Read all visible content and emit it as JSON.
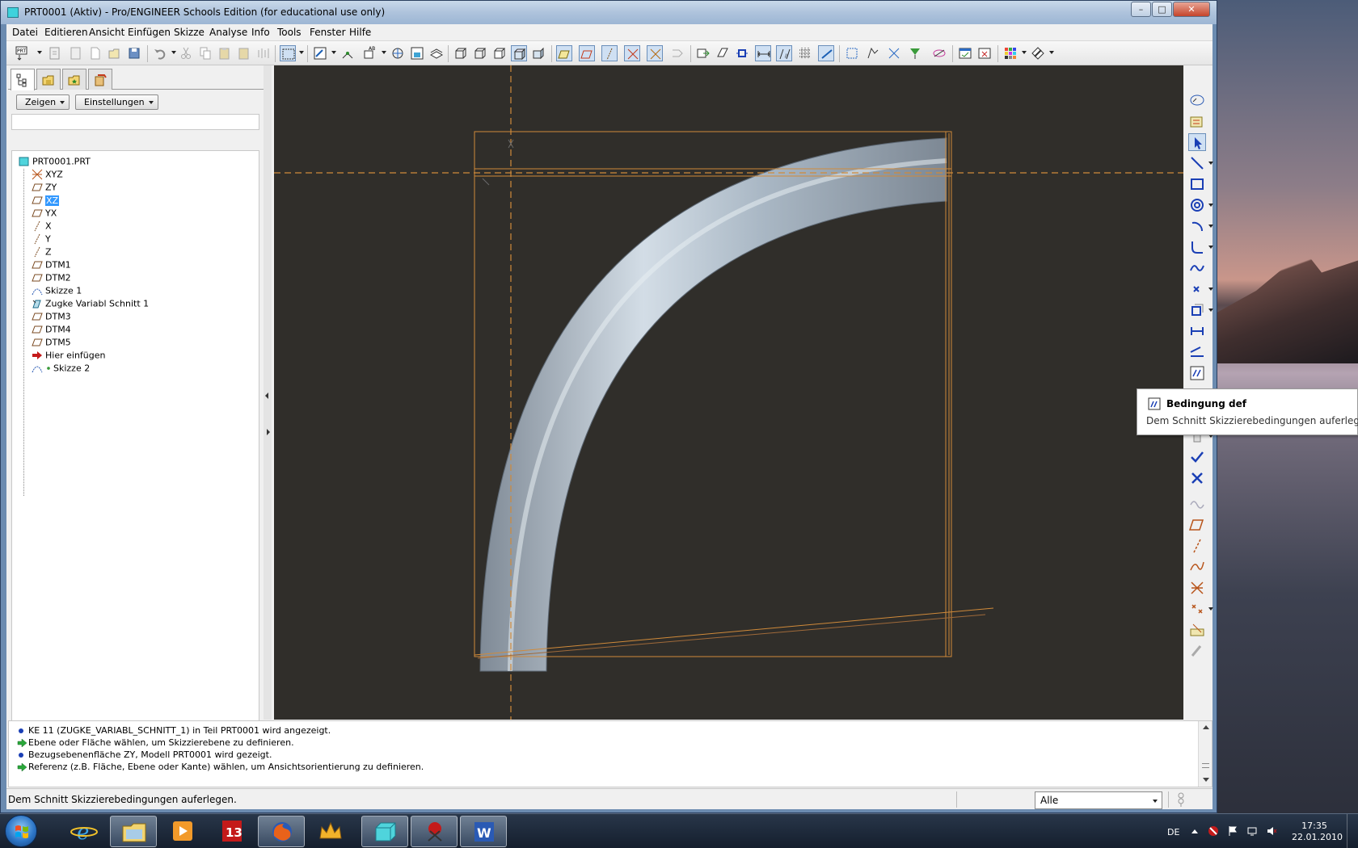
{
  "window": {
    "title": "PRT0001 (Aktiv) - Pro/ENGINEER Schools Edition (for educational use only)",
    "minimize": "–",
    "maximize": "□",
    "close": "✕"
  },
  "menubar": {
    "items": [
      "Datei",
      "Editieren",
      "Ansicht",
      "Einfügen",
      "Skizze",
      "Analyse",
      "Info",
      "Tools",
      "Fenster",
      "Hilfe"
    ]
  },
  "leftpanel": {
    "show_button": "Zeigen",
    "settings_button": "Einstellungen",
    "tree": {
      "root": "PRT0001.PRT",
      "items": [
        {
          "label": "XYZ",
          "icon": "csys-icon"
        },
        {
          "label": "ZY",
          "icon": "datum-plane-icon"
        },
        {
          "label": "XZ",
          "icon": "datum-plane-icon",
          "selected": true
        },
        {
          "label": "YX",
          "icon": "datum-plane-icon"
        },
        {
          "label": "X",
          "icon": "datum-axis-icon"
        },
        {
          "label": "Y",
          "icon": "datum-axis-icon"
        },
        {
          "label": "Z",
          "icon": "datum-axis-icon"
        },
        {
          "label": "DTM1",
          "icon": "datum-plane-icon"
        },
        {
          "label": "DTM2",
          "icon": "datum-plane-icon"
        },
        {
          "label": "Skizze 1",
          "icon": "sketch-icon"
        },
        {
          "label": "Zugke Variabl Schnitt 1",
          "icon": "sweep-feature-icon"
        },
        {
          "label": "DTM3",
          "icon": "datum-plane-icon"
        },
        {
          "label": "DTM4",
          "icon": "datum-plane-icon"
        },
        {
          "label": "DTM5",
          "icon": "datum-plane-icon"
        },
        {
          "label": "Hier einfügen",
          "icon": "insert-here-arrow-icon"
        },
        {
          "label": "Skizze 2",
          "icon": "sketch-icon"
        }
      ]
    }
  },
  "tooltip": {
    "title": "Bedingung def",
    "description": "Dem Schnitt Skizzierebedingungen auferlegen."
  },
  "messages": [
    {
      "type": "info",
      "text": "KE 11 (ZUGKE_VARIABL_SCHNITT_1) in Teil PRT0001 wird angezeigt."
    },
    {
      "type": "prompt",
      "text": "Ebene oder Fläche wählen, um Skizzierebene zu definieren."
    },
    {
      "type": "info",
      "text": "Bezugsebenenfläche ZY, Modell PRT0001 wird gezeigt."
    },
    {
      "type": "prompt",
      "text": "Referenz (z.B. Fläche, Ebene oder Kante) wählen, um Ansichtsorientierung zu definieren."
    }
  ],
  "statusbar": {
    "text": "Dem Schnitt Skizzierebedingungen auferlegen.",
    "filter_value": "Alle"
  },
  "taskbar": {
    "language": "DE",
    "time": "17:35",
    "date": "22.01.2010"
  },
  "colors": {
    "canvas_background": "#302e2a",
    "sketch_reference": "#d08a3a",
    "pipe_surface": "#b9c6d2",
    "selection": "#3399ff"
  }
}
